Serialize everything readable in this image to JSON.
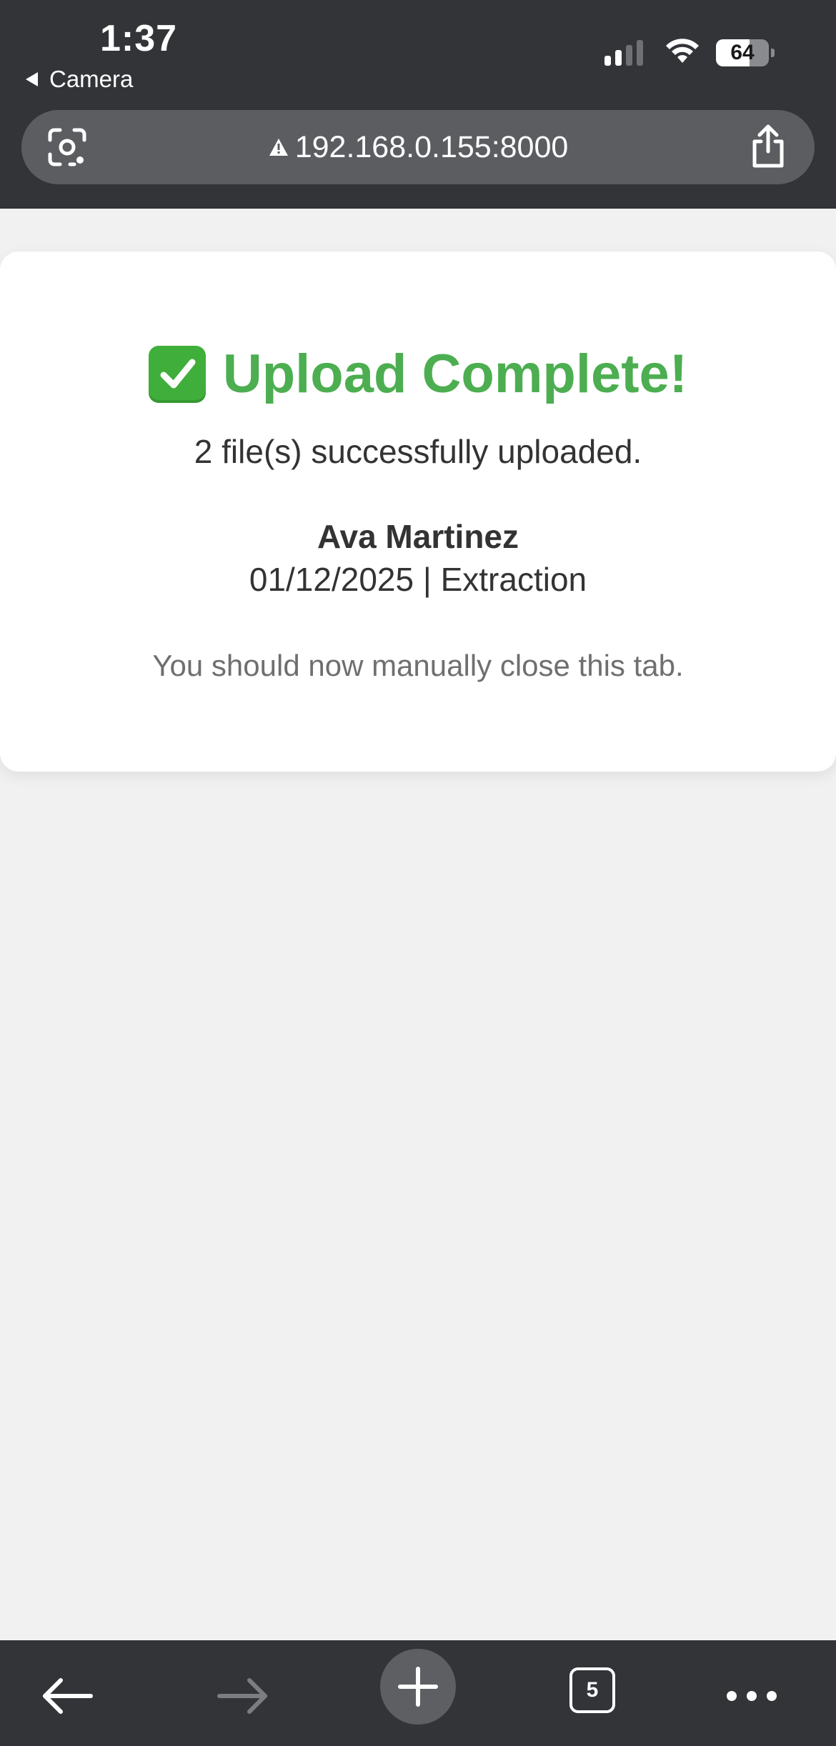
{
  "status_bar": {
    "time": "1:37",
    "back_app": "Camera",
    "battery_percent": "64",
    "battery_level": 0.64,
    "signal_bars_active": 2,
    "signal_bars_total": 4
  },
  "browser": {
    "url": "192.168.0.155:8000",
    "lens_icon": "lens-icon",
    "share_icon": "share-icon",
    "insecure_icon": "warning-triangle-icon"
  },
  "page": {
    "title": "Upload Complete!",
    "title_icon": "green-check-emoji",
    "subtitle": "2 file(s) successfully uploaded.",
    "name": "Ava Martinez",
    "meta": "01/12/2025 | Extraction",
    "note": "You should now manually close this tab."
  },
  "toolbar": {
    "tab_count": "5"
  },
  "colors": {
    "chrome": "#323438",
    "urlbar": "#5b5d61",
    "accent_green": "#4cae50",
    "page_bg": "#f1f1f1"
  }
}
